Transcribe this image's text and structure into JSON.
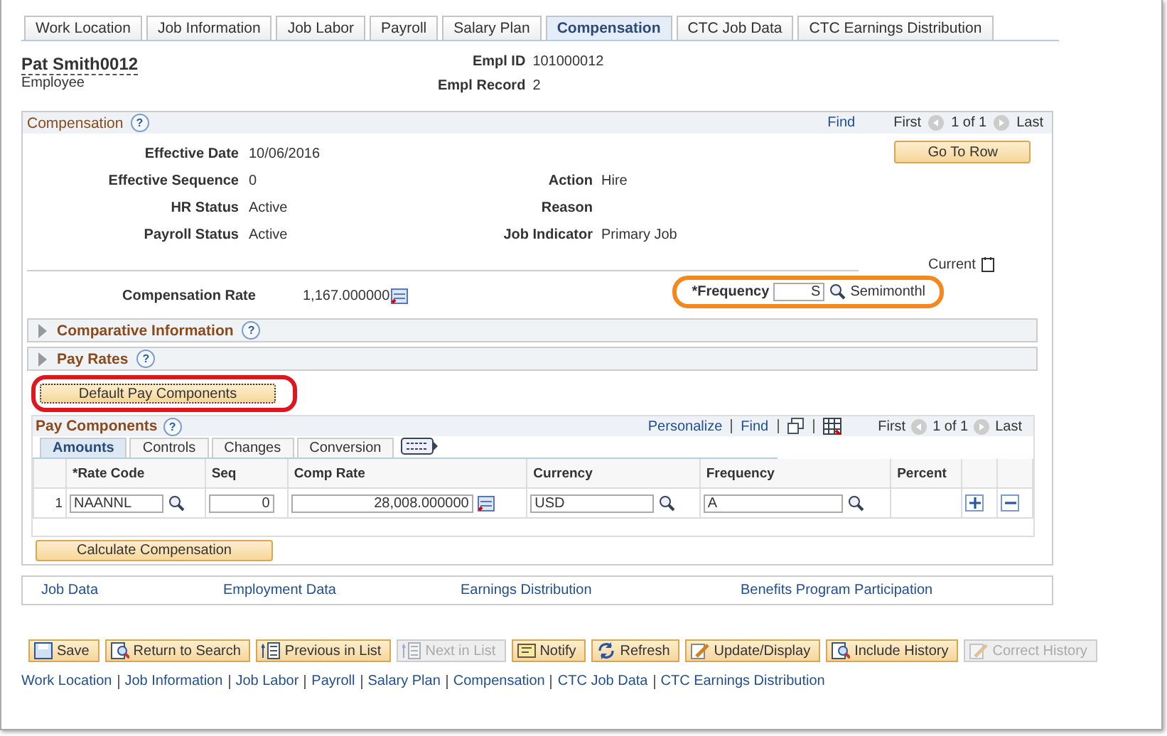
{
  "tabs": [
    {
      "label": "Work Location",
      "selected": false
    },
    {
      "label": "Job Information",
      "selected": false
    },
    {
      "label": "Job Labor",
      "selected": false
    },
    {
      "label": "Payroll",
      "selected": false
    },
    {
      "label": "Salary Plan",
      "selected": false
    },
    {
      "label": "Compensation",
      "selected": true
    },
    {
      "label": "CTC Job Data",
      "selected": false
    },
    {
      "label": "CTC Earnings Distribution",
      "selected": false
    }
  ],
  "employee": {
    "name": "Pat Smith0012",
    "role": "Employee",
    "fields": [
      {
        "label": "Empl ID",
        "value": "101000012"
      },
      {
        "label": "Empl Record",
        "value": "2"
      }
    ]
  },
  "compensation": {
    "title": "Compensation",
    "help": "?",
    "nav": {
      "find": "Find",
      "first": "First",
      "count": "1 of 1",
      "last": "Last"
    },
    "go_to_row": "Go To Row",
    "rows": [
      {
        "left": {
          "label": "Effective Date",
          "value": "10/06/2016"
        }
      },
      {
        "left": {
          "label": "Effective Sequence",
          "value": "0"
        },
        "right": {
          "label": "Action",
          "value": "Hire"
        }
      },
      {
        "left": {
          "label": "HR Status",
          "value": "Active"
        },
        "right": {
          "label": "Reason"
        }
      },
      {
        "left": {
          "label": "Payroll Status",
          "value": "Active"
        },
        "right": {
          "label": "Job Indicator",
          "value": "Primary Job"
        }
      }
    ],
    "current_label": "Current",
    "rate_label": "Compensation Rate",
    "rate_value": "1,167.000000",
    "frequency": {
      "label": "*Frequency",
      "value": "S",
      "description": "Semimonthl"
    },
    "sections": [
      {
        "title": "Comparative Information",
        "help": "?",
        "expanded": false
      },
      {
        "title": "Pay Rates",
        "help": "?",
        "expanded": false
      }
    ],
    "default_button": "Default Pay Components"
  },
  "pay_components": {
    "title": "Pay Components",
    "help": "?",
    "nav": {
      "personalize": "Personalize",
      "find": "Find",
      "first": "First",
      "count": "1 of 1",
      "last": "Last"
    },
    "tabs": [
      {
        "label": "Amounts",
        "selected": true
      },
      {
        "label": "Controls",
        "selected": false
      },
      {
        "label": "Changes",
        "selected": false
      },
      {
        "label": "Conversion",
        "selected": false
      }
    ],
    "columns": [
      "*Rate Code",
      "Seq",
      "Comp Rate",
      "Currency",
      "Frequency",
      "Percent"
    ],
    "rows": [
      {
        "number": "1",
        "rate_code": "NAANNL",
        "seq": "0",
        "comp_rate": "28,008.000000",
        "currency": "USD",
        "frequency": "A"
      }
    ],
    "calculate_button": "Calculate Compensation"
  },
  "links": [
    "Job Data",
    "Employment Data",
    "Earnings Distribution",
    "Benefits Program Participation"
  ],
  "toolbar": [
    {
      "label": "Save",
      "kind": "save",
      "disabled": false
    },
    {
      "label": "Return to Search",
      "kind": "search",
      "disabled": false
    },
    {
      "label": "Previous in List",
      "kind": "list",
      "disabled": false
    },
    {
      "label": "Next in List",
      "kind": "list",
      "disabled": true
    },
    {
      "label": "Notify",
      "kind": "note",
      "disabled": false
    },
    {
      "label": "Refresh",
      "kind": "refresh",
      "disabled": false
    },
    {
      "label": "Update/Display",
      "kind": "pencil",
      "disabled": false
    },
    {
      "label": "Include History",
      "kind": "search",
      "disabled": false
    },
    {
      "label": "Correct History",
      "kind": "pencil",
      "disabled": true
    }
  ],
  "footer_links": [
    "Work Location",
    "Job Information",
    "Job Labor",
    "Payroll",
    "Salary Plan",
    "Compensation",
    "CTC Job Data",
    "CTC Earnings Distribution"
  ]
}
